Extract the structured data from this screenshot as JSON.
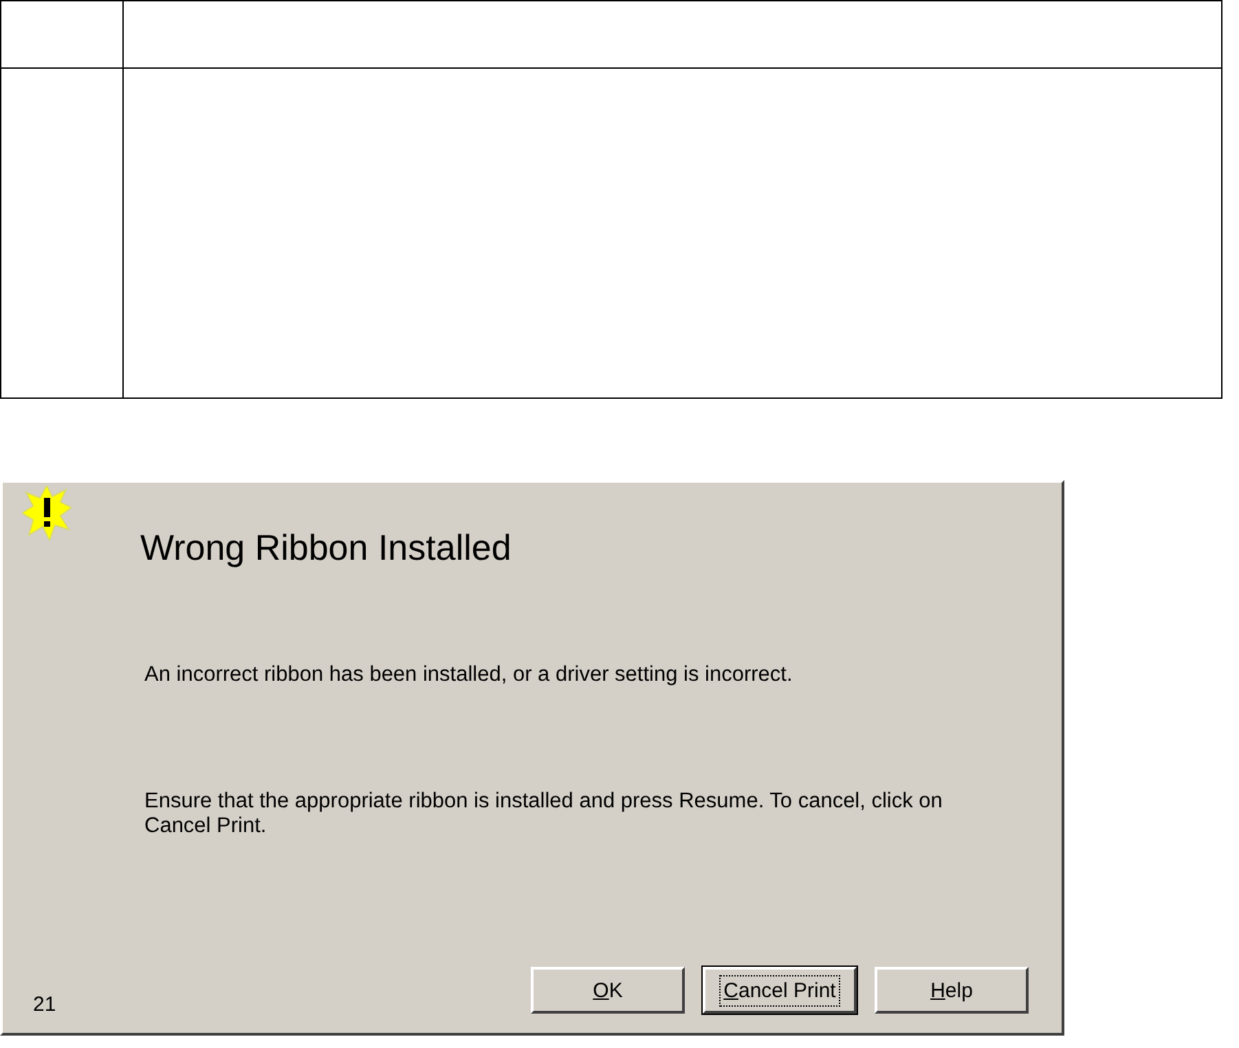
{
  "dialog": {
    "title": "Wrong Ribbon Installed",
    "messages": [
      "An incorrect ribbon has been installed, or a driver setting is incorrect.",
      "Ensure that the appropriate ribbon is installed and press Resume. To cancel, click on Cancel Print."
    ],
    "code": "21",
    "buttons": [
      {
        "access_key": "O",
        "label_rest": "K",
        "focused": false
      },
      {
        "access_key": "C",
        "label_rest": "ancel Print",
        "focused": true
      },
      {
        "access_key": "H",
        "label_rest": "elp",
        "focused": false
      }
    ]
  }
}
